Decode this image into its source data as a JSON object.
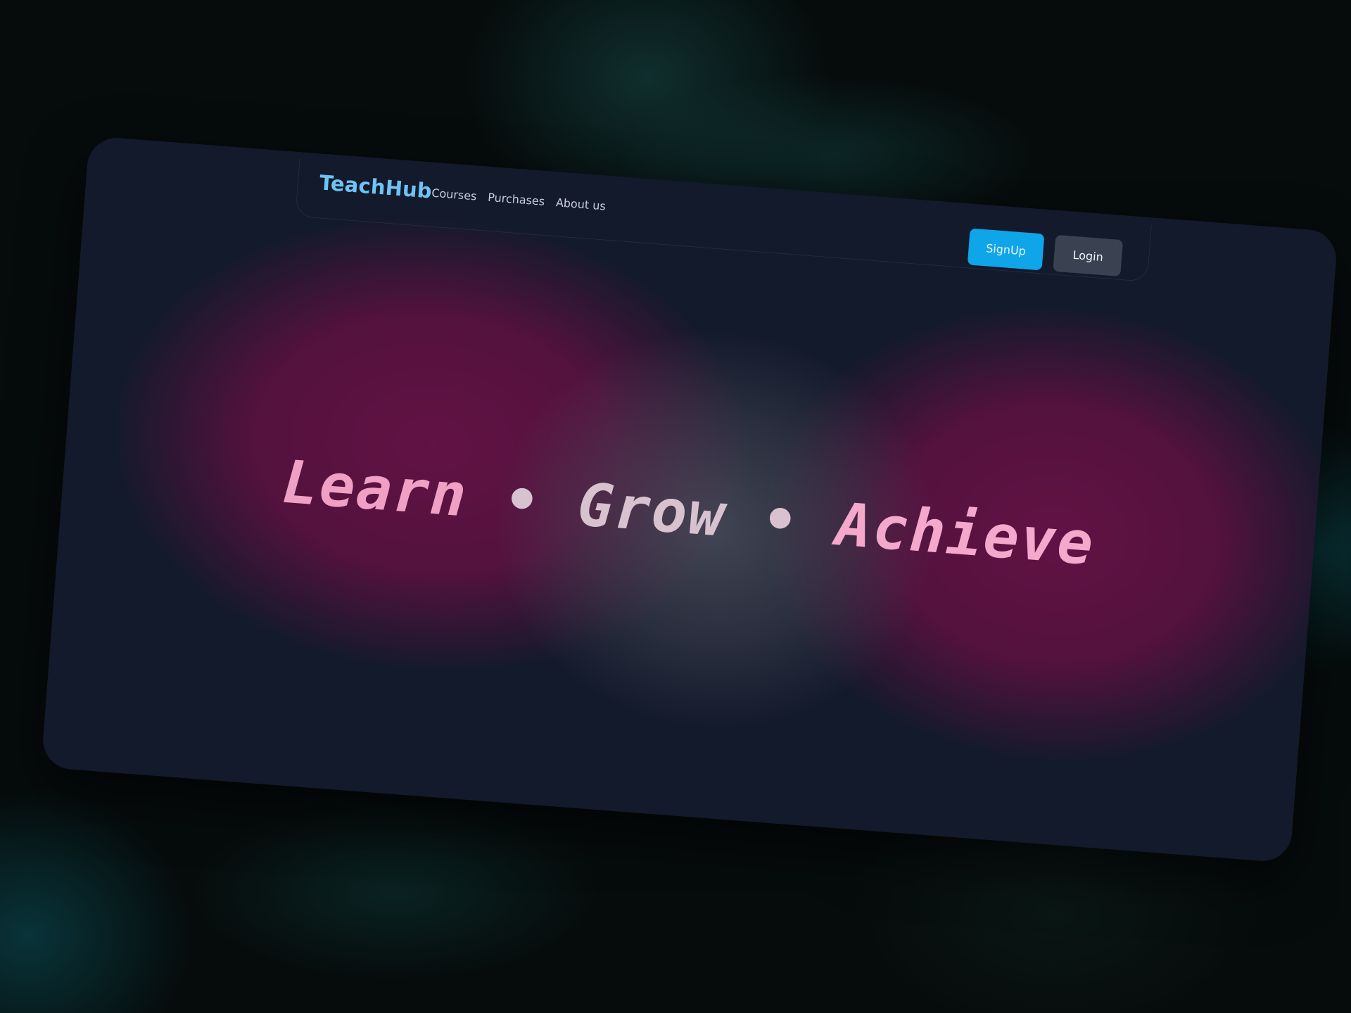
{
  "header": {
    "brand": "TeachHub",
    "nav": [
      "Courses",
      "Purchases",
      "About us"
    ],
    "signup_label": "SignUp",
    "login_label": "Login"
  },
  "hero": {
    "word1": "Learn",
    "sep1": "•",
    "word2": "Grow",
    "sep2": "•",
    "word3": "Achieve"
  },
  "colors": {
    "brand": "#6ec3f4",
    "signup_button": "#0ea5e9",
    "login_button": "#3a4150",
    "card_background": "#131a2b",
    "hero_text": "#f0a0c4"
  }
}
